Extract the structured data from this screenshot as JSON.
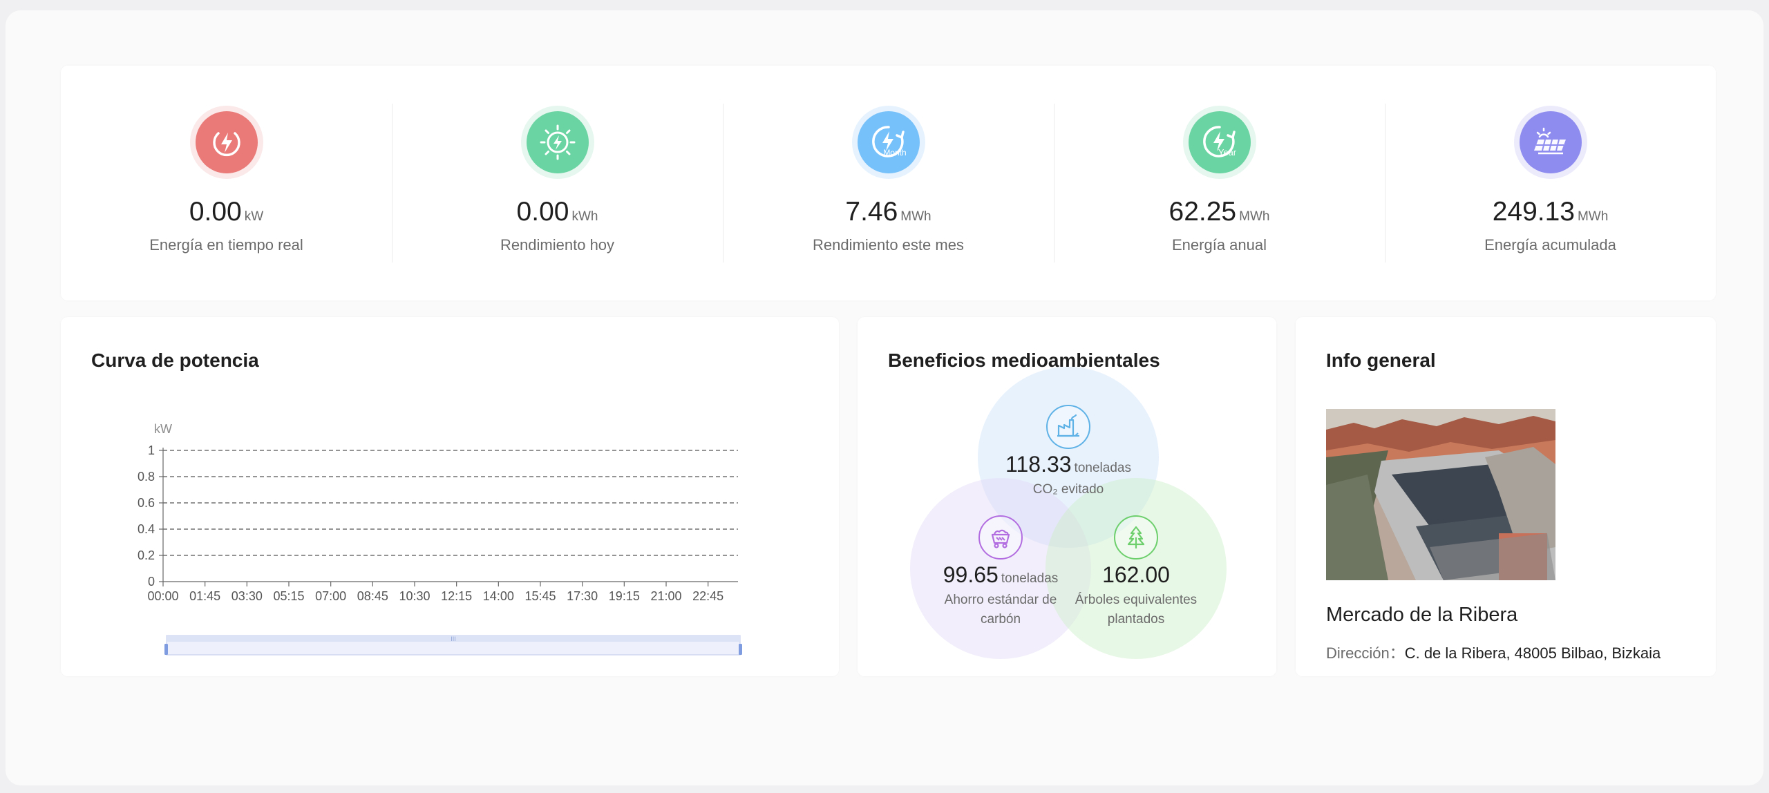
{
  "stats": [
    {
      "value": "0.00",
      "unit": "kW",
      "label": "Energía en tiempo real",
      "icon": "realtime-power-icon",
      "color": "#e97a78",
      "ring": "#fbe9e9"
    },
    {
      "value": "0.00",
      "unit": "kWh",
      "label": "Rendimiento hoy",
      "icon": "sun-energy-icon",
      "color": "#6ad4a2",
      "ring": "#e6f7ef"
    },
    {
      "value": "7.46",
      "unit": "MWh",
      "label": "Rendimiento este mes",
      "icon": "month-energy-icon",
      "icon_text": "Month",
      "color": "#76c1fa",
      "ring": "#e6f3fe"
    },
    {
      "value": "62.25",
      "unit": "MWh",
      "label": "Energía anual",
      "icon": "year-energy-icon",
      "icon_text": "Year",
      "color": "#6ad4a2",
      "ring": "#e6f7ef"
    },
    {
      "value": "249.13",
      "unit": "MWh",
      "label": "Energía acumulada",
      "icon": "solar-panel-icon",
      "color": "#8f8cf0",
      "ring": "#ecebfc"
    }
  ],
  "power_curve": {
    "title": "Curva de potencia",
    "chart_data": {
      "type": "line",
      "ylabel": "kW",
      "ylim": [
        0,
        1
      ],
      "y_ticks": [
        "0",
        "0.2",
        "0.4",
        "0.6",
        "0.8",
        "1"
      ],
      "x_ticks": [
        "00:00",
        "01:45",
        "03:30",
        "05:15",
        "07:00",
        "08:45",
        "10:30",
        "12:15",
        "14:00",
        "15:45",
        "17:30",
        "19:15",
        "21:00",
        "22:45"
      ],
      "series": [],
      "grid": true,
      "slider_handle_label": "III"
    }
  },
  "environment": {
    "title": "Beneficios medioambientales",
    "co2": {
      "value": "118.33",
      "unit": "toneladas",
      "label": "CO₂ evitado",
      "icon": "factory-icon",
      "color": "#5fb2e6"
    },
    "coal": {
      "value": "99.65",
      "unit": "toneladas",
      "label": "Ahorro estándar de carbón",
      "icon": "coal-cart-icon",
      "color": "#b26ee0"
    },
    "trees": {
      "value": "162.00",
      "unit": "",
      "label": "Árboles equivalentes plantados",
      "icon": "tree-icon",
      "color": "#6ccf6c"
    }
  },
  "info": {
    "title": "Info general",
    "site_name": "Mercado de la Ribera",
    "address_label": "Dirección：",
    "address": "C. de la Ribera, 48005 Bilbao, Bizkaia"
  }
}
